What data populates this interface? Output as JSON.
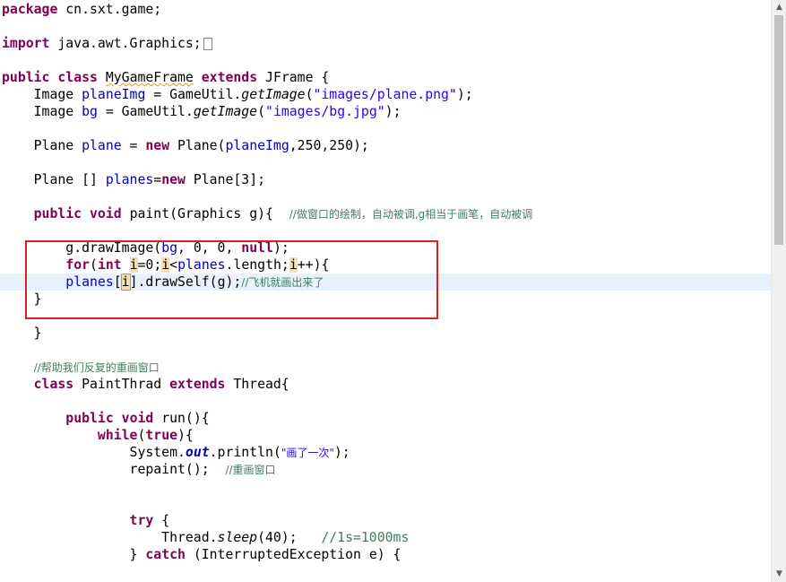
{
  "code": {
    "l1": {
      "kw": "package",
      "rest": " cn.sxt.game;"
    },
    "l2": {
      "kw": "import",
      "rest": " java.awt.Graphics;"
    },
    "l3": {
      "kw1": "public",
      "kw2": "class",
      "name": "MyGameFrame",
      "kw3": "extends",
      "rest": " JFrame {"
    },
    "l4": {
      "type": "Image ",
      "field": "planeImg",
      "mid": " = GameUtil.",
      "method": "getImage",
      "open": "(",
      "str": "\"images/plane.png\"",
      "close": ");"
    },
    "l5": {
      "type": "Image ",
      "field": "bg",
      "mid": " = GameUtil.",
      "method": "getImage",
      "open": "(",
      "str": "\"images/bg.jpg\"",
      "close": ");"
    },
    "l6": {
      "type": "Plane ",
      "field": "plane",
      "mid": " = ",
      "kw": "new",
      "a": " Plane(",
      "arg": "planeImg",
      "b": ",250,250);"
    },
    "l7": {
      "type": "Plane [] ",
      "field": "planes",
      "eq": "=",
      "kw": "new",
      "rest": " Plane[3];"
    },
    "l8": {
      "kw1": "public",
      "kw2": "void",
      "sig": " paint(Graphics g){  ",
      "comment": "//做窗口的绘制，自动被调,g相当于画笔，自动被调"
    },
    "l9": {
      "a": "g.drawImage(",
      "f": "bg",
      "b": ", 0, 0, ",
      "kw": "null",
      "c": ");"
    },
    "l10": {
      "kw1": "for",
      "a": "(",
      "kw2": "int",
      "sp": " ",
      "i1": "i",
      "b": "=0;",
      "i2": "i",
      "c": "<",
      "f": "planes",
      "d": ".length;",
      "i3": "i",
      "e": "++){"
    },
    "l11": {
      "f": "planes",
      "a": "[",
      "i": "i",
      "b": "].drawSelf(g);",
      "comment": "//飞机就画出来了"
    },
    "l12": {
      "text": "}"
    },
    "l13": {
      "text": "}"
    },
    "l14": {
      "comment": "//帮助我们反复的重画窗口"
    },
    "l15": {
      "kw1": "class",
      "name": " PaintThrad ",
      "kw2": "extends",
      "rest": " Thread{"
    },
    "l16": {
      "kw1": "public",
      "kw2": "void",
      "rest": " run(){"
    },
    "l17": {
      "kw1": "while",
      "a": "(",
      "kw2": "true",
      "b": "){"
    },
    "l18": {
      "a": "System.",
      "sf": "out",
      "b": ".println(",
      "str": "\"画了一次\"",
      "c": ");"
    },
    "l19": {
      "a": "repaint();  ",
      "comment": "//重画窗口"
    },
    "l20": {
      "kw": "try",
      "rest": " {"
    },
    "l21": {
      "a": "Thread.",
      "m": "sleep",
      "b": "(40);   ",
      "comment": "//1s=1000ms"
    },
    "l22": {
      "a": "} ",
      "kw": "catch",
      "b": " (InterruptedException e) {"
    }
  },
  "scrollbar": {
    "up": "▲",
    "down": "▼"
  },
  "colors": {
    "keyword": "#7f0055",
    "string": "#2a00ff",
    "field": "#0000c0",
    "comment": "#3f7f5f",
    "highlight_box": "#e0201b",
    "current_line": "#e8f2fe"
  }
}
